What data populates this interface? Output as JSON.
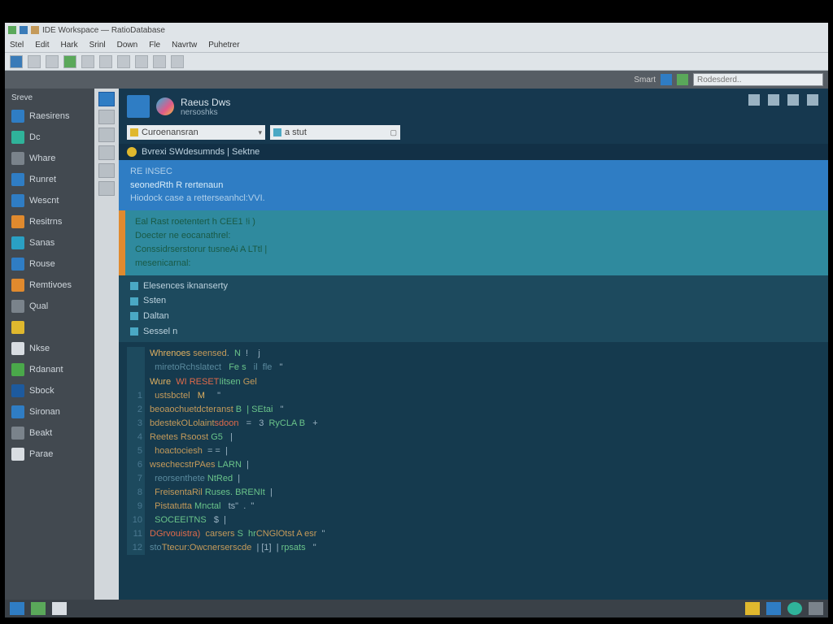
{
  "window": {
    "title": "IDE Workspace — RatioDatabase"
  },
  "menubar": [
    "Stel",
    "Edit",
    "Hark",
    "Srinl",
    "Down",
    "Fle",
    "Navrtw",
    "Puhetrer"
  ],
  "toolbar2": {
    "right_label": "Smart",
    "search_placeholder": "Rodesderd.."
  },
  "sidebar": {
    "header": "Sreve",
    "items": [
      {
        "label": "Raesirens",
        "icon": "ic-blue"
      },
      {
        "label": "Dc",
        "icon": "ic-teal"
      },
      {
        "label": "Whare",
        "icon": "ic-grey"
      },
      {
        "label": "Runret",
        "icon": "ic-blue"
      },
      {
        "label": "Wescnt",
        "icon": "ic-blue"
      },
      {
        "label": "Resitrns",
        "icon": "ic-orange"
      },
      {
        "label": "Sanas",
        "icon": "ic-cyan"
      },
      {
        "label": "Rouse",
        "icon": "ic-blue"
      },
      {
        "label": "Remtivoes",
        "icon": "ic-orange"
      },
      {
        "label": "Qual",
        "icon": "ic-grey"
      },
      {
        "label": "",
        "icon": "ic-yellow"
      },
      {
        "label": "Nkse",
        "icon": "ic-white"
      },
      {
        "label": "Rdanant",
        "icon": "ic-green"
      },
      {
        "label": "Sbock",
        "icon": "ic-dblue"
      },
      {
        "label": "Sironan",
        "icon": "ic-blue"
      },
      {
        "label": "Beakt",
        "icon": "ic-grey"
      },
      {
        "label": "Parae",
        "icon": "ic-white"
      }
    ]
  },
  "content_header": {
    "title": "Raeus Dws",
    "subtitle": "nersoshks"
  },
  "address": {
    "path": "Curoenansran",
    "search": "a stut"
  },
  "crumb": "Bvrexi SWdesumnds | Sektne",
  "highlight": {
    "l1": "RE INSEC",
    "l2": "seonedRth R rertenaun",
    "l3": "Hiodock case a retterseanhcl:VVI."
  },
  "orange_block": [
    "Eal Rast roetentert h CEE1 !i )",
    "Doecter  ne eocanathrel:",
    "Conssidrserstorur  tusneAi A LTtl |",
    "mesenicarnal:"
  ],
  "tree": [
    "Elesences iknanserty",
    "Ssten",
    "Daltan",
    "Sessel n"
  ],
  "code": [
    {
      "g": "",
      "t": [
        [
          "kw",
          "Whrenoes "
        ],
        [
          "fn",
          "seensed"
        ],
        [
          "",
          ".  "
        ],
        [
          "str",
          "N"
        ],
        [
          "",
          "  !    j"
        ]
      ]
    },
    {
      "g": "",
      "t": [
        [
          "cm",
          "  miretoRchslatect"
        ],
        [
          "",
          "   "
        ],
        [
          "str",
          "Fe s"
        ],
        [
          "",
          "   "
        ],
        [
          "cm",
          "il  fle"
        ],
        [
          "",
          "   \""
        ]
      ]
    },
    {
      "g": "",
      "t": [
        [
          "kw",
          "Wure  "
        ],
        [
          "err",
          "WI RESET"
        ],
        [
          "str",
          "Iitsen"
        ],
        [
          "fn",
          " Gel"
        ]
      ]
    },
    {
      "g": "1",
      "t": [
        [
          "",
          "  "
        ],
        [
          "fn",
          "ustsbctel"
        ],
        [
          "",
          "   "
        ],
        [
          "kw",
          "M"
        ],
        [
          "",
          "     \""
        ]
      ]
    },
    {
      "g": "2",
      "t": [
        [
          "fn",
          "beoaochuetdcteranst"
        ],
        [
          "str",
          " B  | SEtai"
        ],
        [
          "",
          "   \""
        ]
      ]
    },
    {
      "g": "3",
      "t": [
        [
          "fn",
          "bdestekOLolaint"
        ],
        [
          "err",
          "sdoon"
        ],
        [
          "",
          "   ="
        ],
        [
          "",
          "   3  "
        ],
        [
          "str",
          "RyCLA B"
        ],
        [
          "",
          "   +"
        ]
      ]
    },
    {
      "g": "4",
      "t": [
        [
          "fn",
          "Reetes Rsoost"
        ],
        [
          "str",
          " G5"
        ],
        [
          "",
          "   |"
        ]
      ]
    },
    {
      "g": "5",
      "t": [
        [
          "fn",
          "  hoactociesh"
        ],
        [
          "",
          "  = =  |"
        ]
      ]
    },
    {
      "g": "6",
      "t": [
        [
          "fn",
          "wsechecstrPAes"
        ],
        [
          "str",
          " LARN"
        ],
        [
          "",
          "  |"
        ]
      ]
    },
    {
      "g": "7",
      "t": [
        [
          "cm",
          "  reorsenthete"
        ],
        [
          "str",
          " NtRed"
        ],
        [
          "",
          "  |"
        ]
      ]
    },
    {
      "g": "8",
      "t": [
        [
          "fn",
          "  FreisentaRil"
        ],
        [
          "str",
          " Ruses. BRENIt"
        ],
        [
          "",
          "  |"
        ]
      ]
    },
    {
      "g": "9",
      "t": [
        [
          "fn",
          "  Pistatutta"
        ],
        [
          "str",
          " Mnctal"
        ],
        [
          "",
          "   ts\""
        ],
        [
          "",
          "  .  \""
        ]
      ]
    },
    {
      "g": "10",
      "t": [
        [
          "",
          "  "
        ],
        [
          "str",
          "SOCEEITNS"
        ],
        [
          "",
          "   $  |"
        ]
      ]
    },
    {
      "g": "11",
      "t": [
        [
          "err",
          "DGrvouistra)"
        ],
        [
          "",
          "  "
        ],
        [
          "fn",
          "carsers"
        ],
        [
          "str",
          " S  hr"
        ],
        [
          "fn",
          "CNGlOtst A esr"
        ],
        [
          "",
          "  \""
        ]
      ]
    },
    {
      "g": "12",
      "t": [
        [
          "cm",
          "sto"
        ],
        [
          "fn",
          "Ttecur:Owcnerserscde"
        ],
        [
          "",
          "  | [1]  | "
        ],
        [
          "str",
          "rpsats"
        ],
        [
          "",
          "   \""
        ]
      ]
    }
  ],
  "colors": {
    "accent": "#2f7dc4",
    "bg": "#15354d",
    "sel": "#2f7dc4"
  }
}
